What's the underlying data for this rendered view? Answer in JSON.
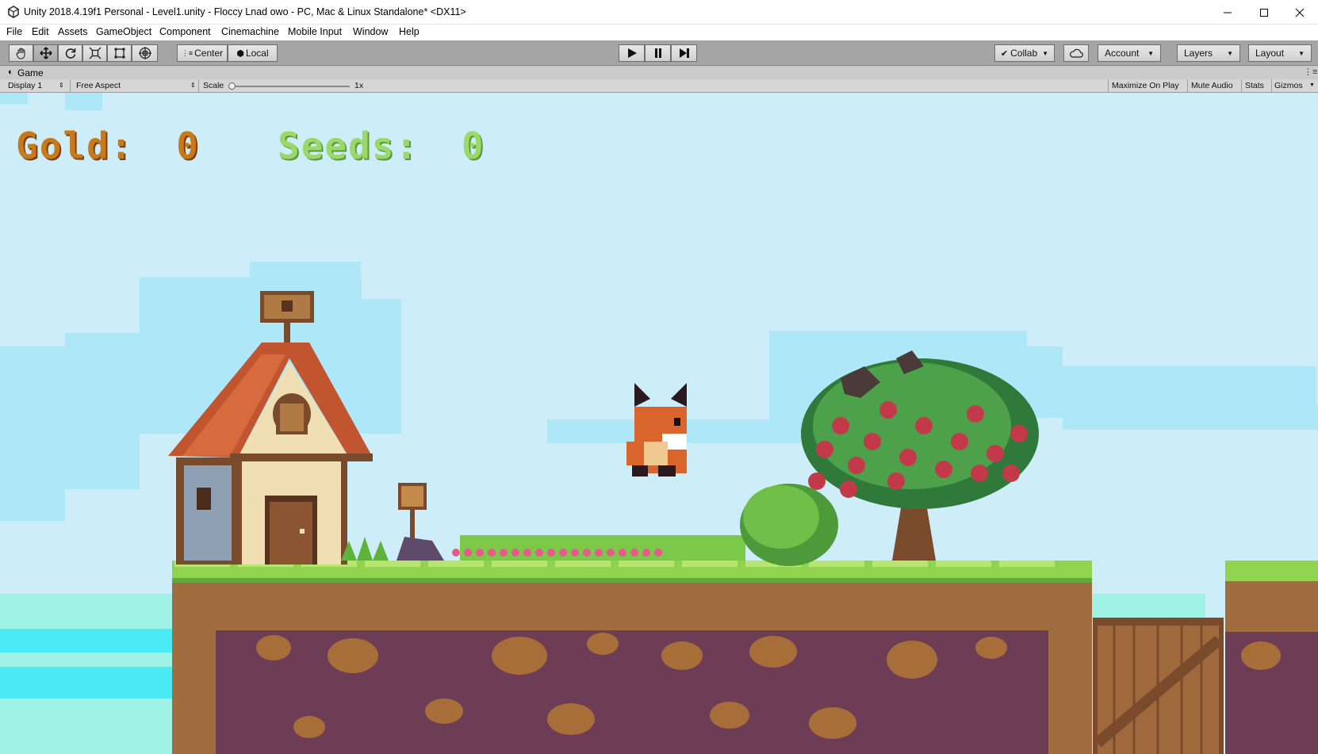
{
  "window": {
    "title": "Unity 2018.4.19f1 Personal - Level1.unity - Floccy Lnad owo - PC, Mac & Linux Standalone* <DX11>"
  },
  "menu": [
    "File",
    "Edit",
    "Assets",
    "GameObject",
    "Component",
    "Cinemachine",
    "Mobile Input",
    "Window",
    "Help"
  ],
  "toolbar": {
    "tools": [
      "hand-tool-icon",
      "move-tool-icon",
      "rotate-tool-icon",
      "scale-tool-icon",
      "rect-tool-icon",
      "transform-tool-icon"
    ],
    "pivot_center": "Center",
    "pivot_local": "Local",
    "collab": "Collab",
    "account": "Account",
    "layers": "Layers",
    "layout": "Layout"
  },
  "game_tab": {
    "label": "Game",
    "display": "Display 1",
    "aspect": "Free Aspect",
    "scale_label": "Scale",
    "scale_value": "1x",
    "maximize": "Maximize On Play",
    "mute": "Mute Audio",
    "stats": "Stats",
    "gizmos": "Gizmos"
  },
  "hud": {
    "gold_label": "Gold:",
    "gold_value": "0",
    "seeds_label": "Seeds:",
    "seeds_value": "0"
  },
  "colors": {
    "sky": "#cdeef9",
    "cloud": "#a9e6f7",
    "gold": "#c8791a",
    "seeds": "#9bd86a",
    "grass": "#8ed24e",
    "dirt": "#9b6a3c",
    "deep_dirt": "#6e3f55",
    "water": "#4ae9f3"
  }
}
